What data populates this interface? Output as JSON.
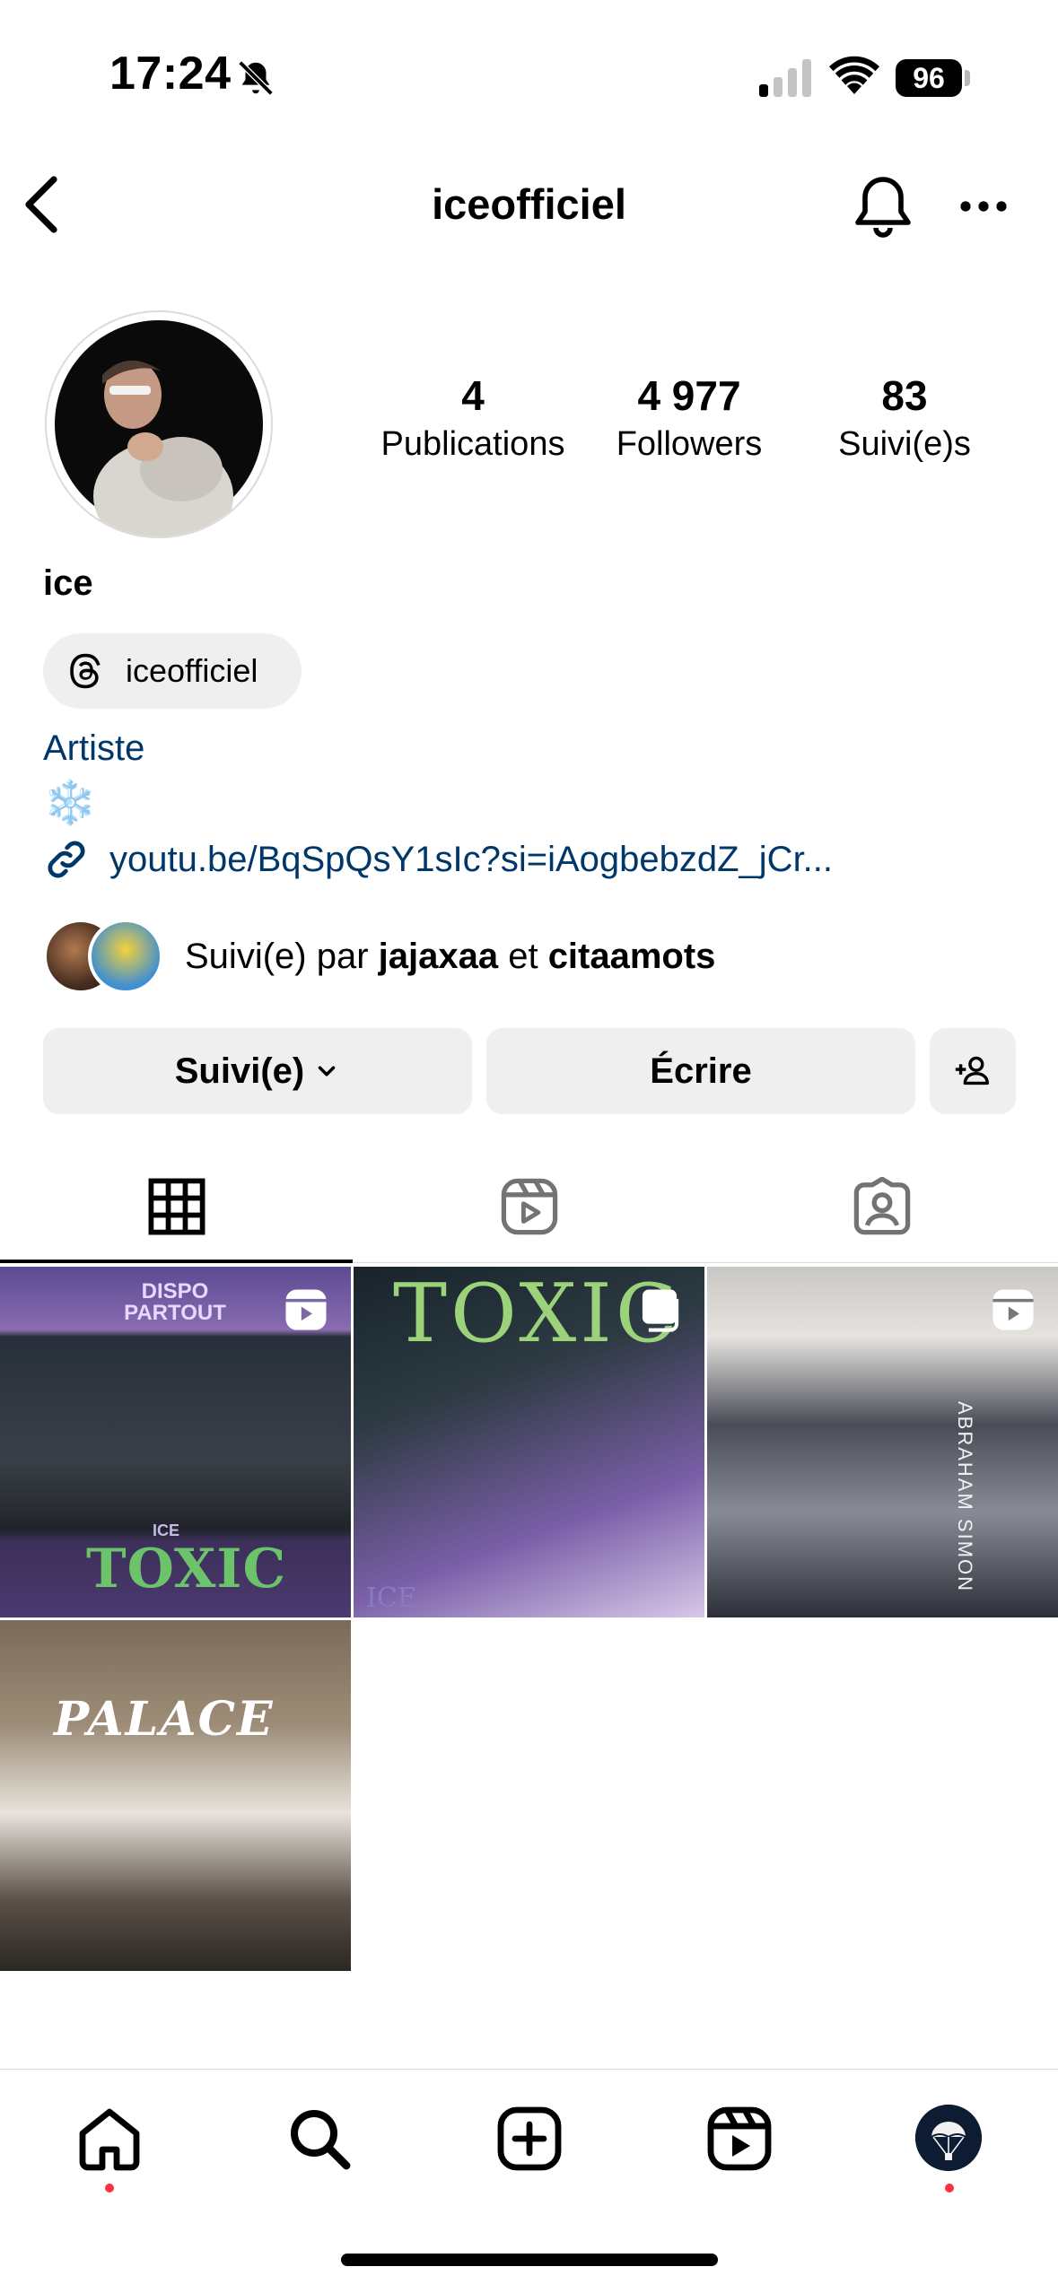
{
  "status_bar": {
    "time": "17:24",
    "battery": "96"
  },
  "header": {
    "username": "iceofficiel"
  },
  "profile": {
    "stats": [
      {
        "value": "4",
        "label": "Publications"
      },
      {
        "value": "4 977",
        "label": "Followers"
      },
      {
        "value": "83",
        "label": "Suivi(e)s"
      }
    ],
    "name": "ice",
    "threads_handle": "iceofficiel",
    "category": "Artiste",
    "bio_emoji": "❄️",
    "link": "youtu.be/BqSpQsY1sIc?si=iAogbebzdZ_jCr...",
    "followed_by": {
      "prefix": "Suivi(e) par ",
      "user1": "jajaxaa",
      "conj": " et ",
      "user2": "citaamots"
    }
  },
  "buttons": {
    "following": "Suivi(e)",
    "message": "Écrire"
  },
  "tabs": [
    "grid-tab",
    "reels-tab",
    "tagged-tab"
  ],
  "posts": [
    {
      "top_text": "DISPO PARTOUT",
      "mid_text": "ICE",
      "bottom_text": "TOXIC",
      "type": "reel"
    },
    {
      "top_text": "TOXIC",
      "corner_text": "ICE",
      "type": "carousel"
    },
    {
      "side_text": "ABRAHAM SIMON",
      "type": "reel"
    },
    {
      "top_text": "PALACE",
      "type": "post"
    }
  ],
  "colors": {
    "link": "#00376b",
    "notification_dot": "#ff3040",
    "button_bg": "#efefef"
  }
}
